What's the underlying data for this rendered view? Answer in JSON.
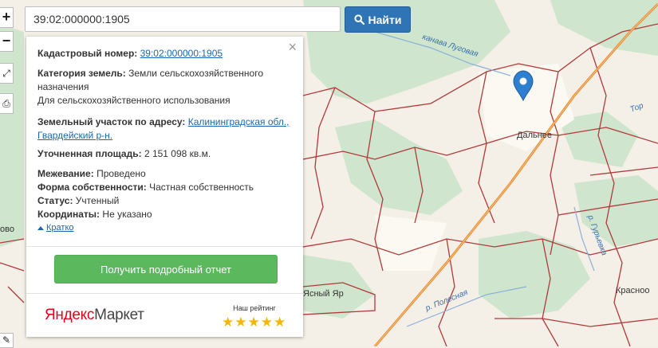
{
  "search": {
    "value": "39:02:000000:1905",
    "button_label": "Найти"
  },
  "map": {
    "labels": {
      "dalnee": "Дальнее",
      "yar": "Ясный Яр",
      "krasnoe": "Красноо",
      "ovo": "ово",
      "oy": "Тор"
    },
    "water": {
      "canal": "канава Луговая",
      "river_poles": "р. Полесная",
      "river_right": "р. Гурьевка"
    }
  },
  "popup": {
    "close": "×",
    "cadastral_label": "Кадастровый номер:",
    "cadastral_value": "39:02:000000:1905",
    "category_label": "Категория земель:",
    "category_value": "Земли сельскохозяйственного назначения",
    "category_usage": "Для сельскохозяйственного использования",
    "address_label": "Земельный участок по адресу:",
    "address_value": "Калининградская обл., Гвардейский р-н.",
    "area_label": "Уточненная площадь:",
    "area_value": "2 151 098 кв.м.",
    "survey_label": "Межевание:",
    "survey_value": "Проведено",
    "ownership_label": "Форма собственности:",
    "ownership_value": "Частная собственность",
    "status_label": "Статус:",
    "status_value": "Учтенный",
    "coords_label": "Координаты:",
    "coords_value": "Не указано",
    "short_link": "Кратко",
    "report_button": "Получить подробный отчет",
    "brand_part1": "Яндекс",
    "brand_part2": "Маркет",
    "rating_label": "Наш рейтинг",
    "rating_stars": 5
  },
  "colors": {
    "search_button": "#2f74b5",
    "report_button": "#5cb85c",
    "boundary": "#b03a3a",
    "road": "#e8882a",
    "forest": "#cfe5cd",
    "marker": "#2f7fd0"
  }
}
